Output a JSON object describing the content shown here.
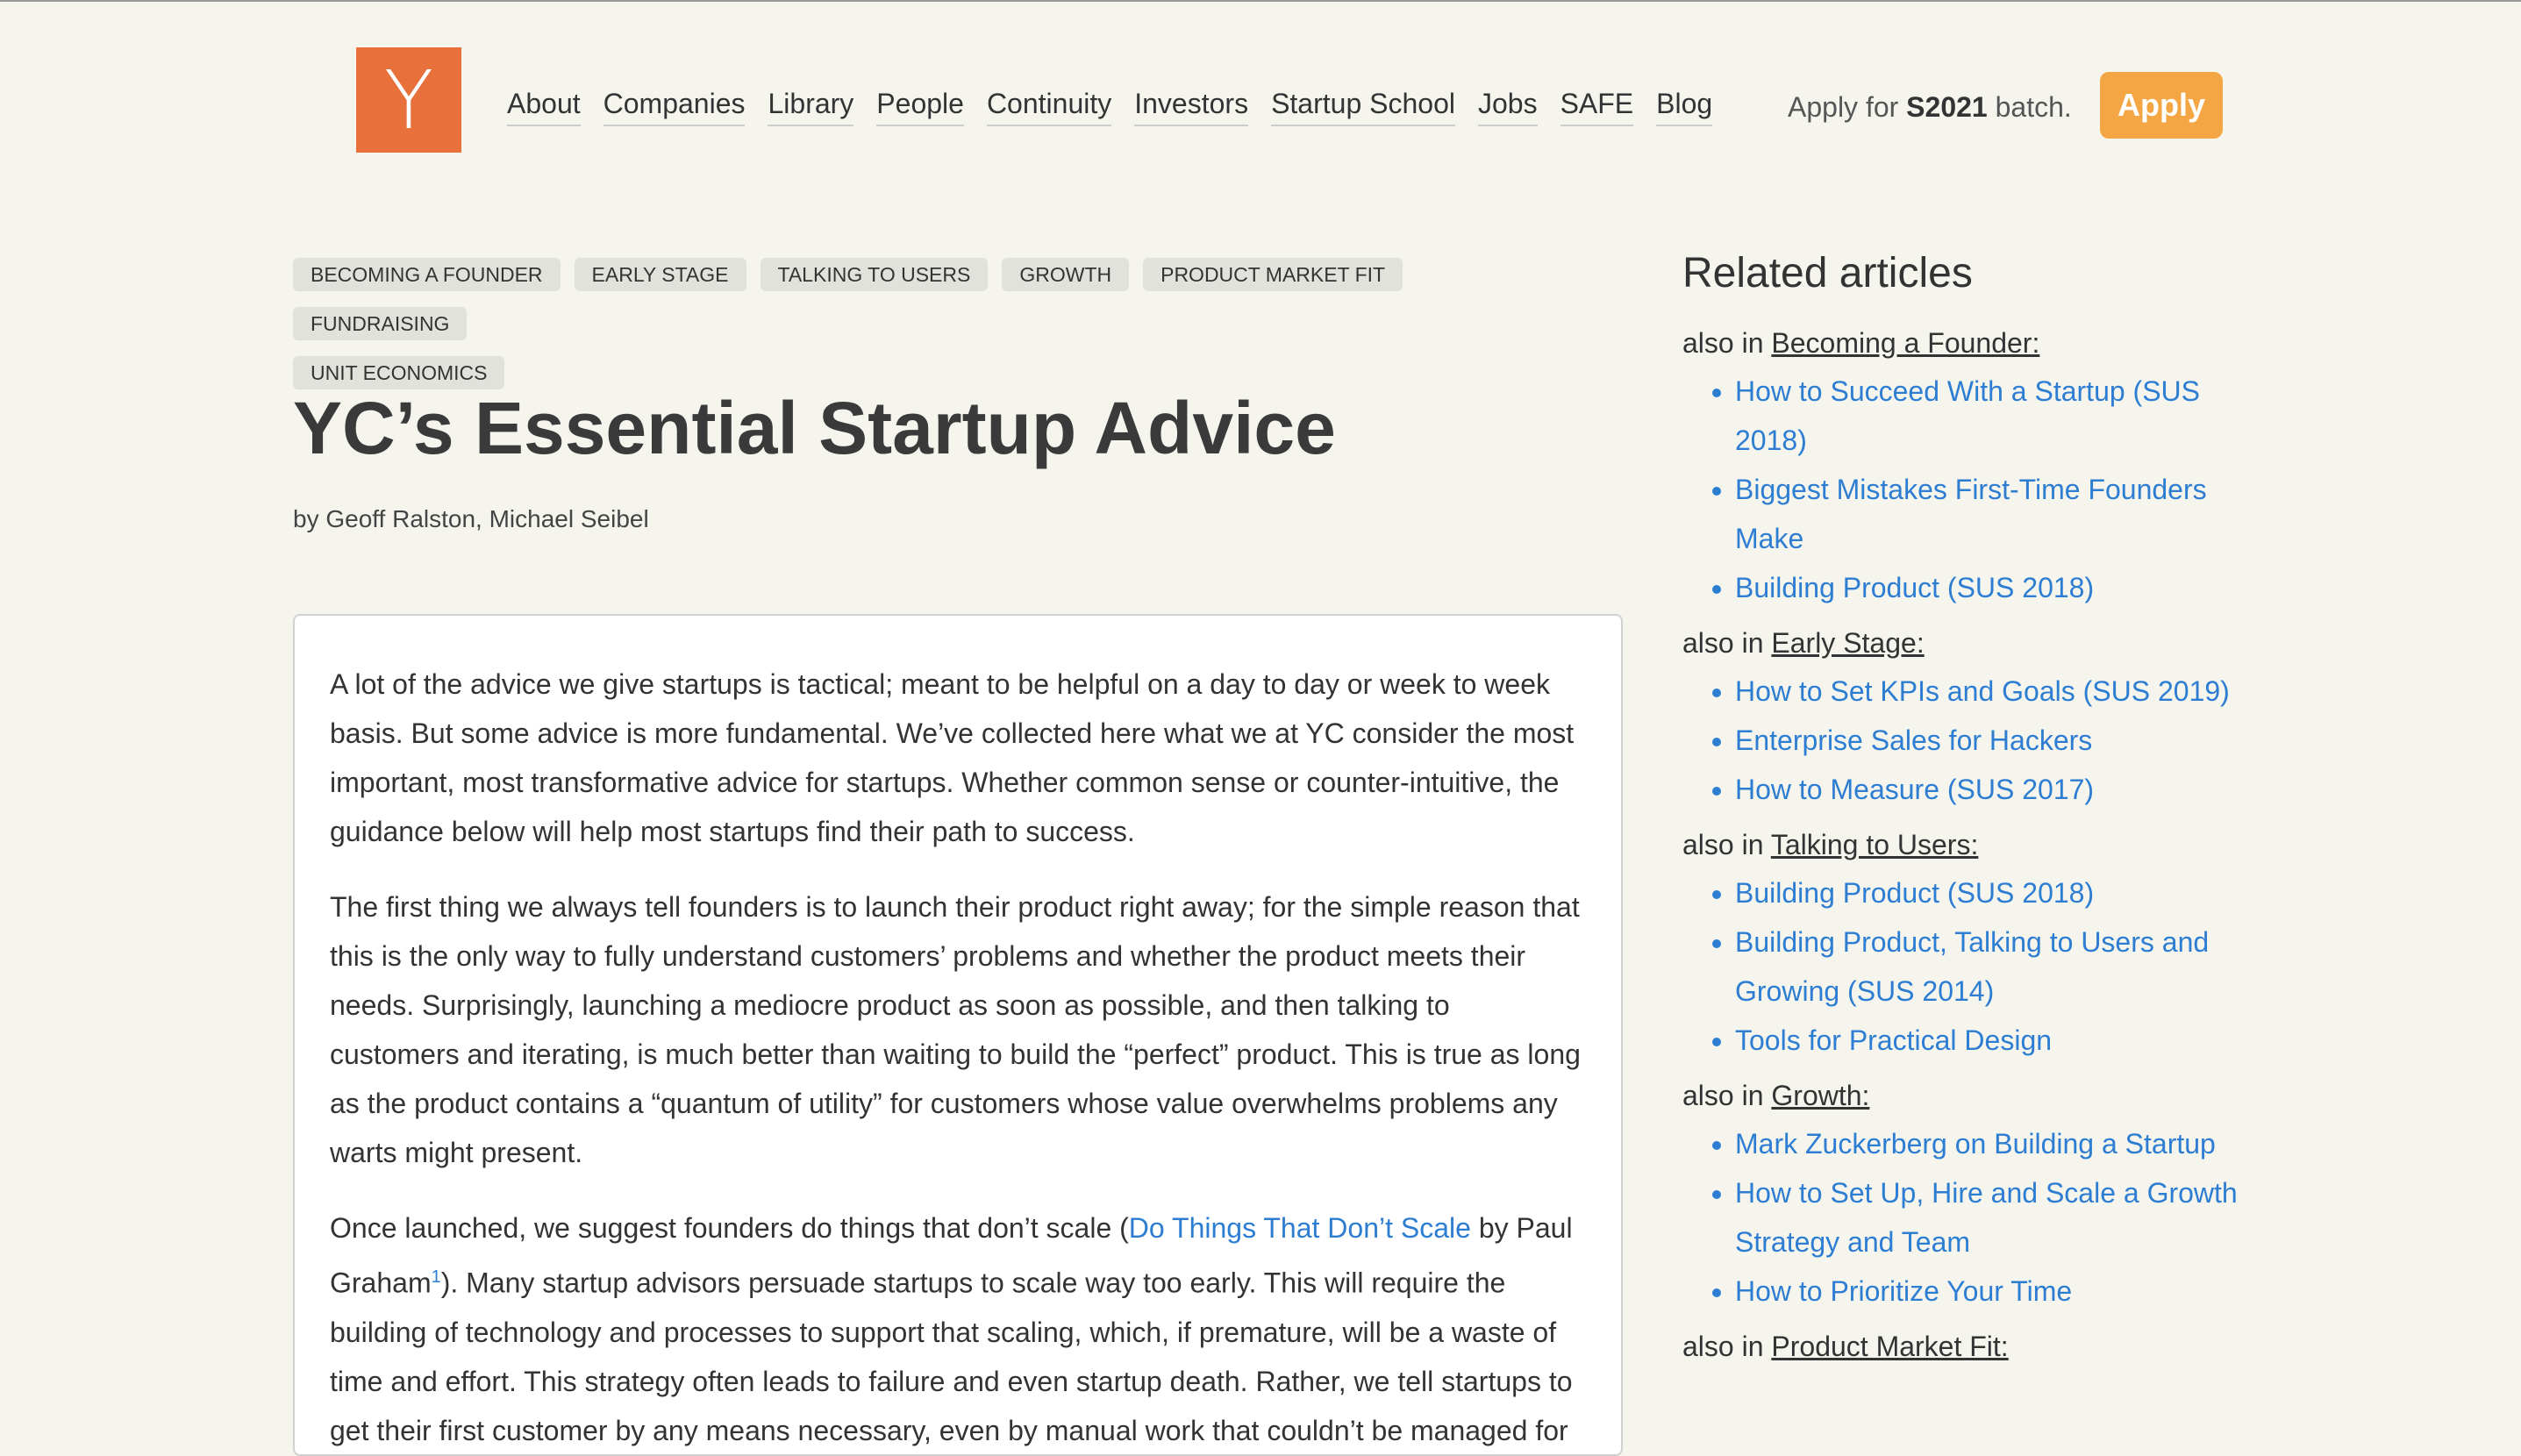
{
  "header": {
    "logo": "Y",
    "nav": [
      "About",
      "Companies",
      "Library",
      "People",
      "Continuity",
      "Investors",
      "Startup School",
      "Jobs",
      "SAFE",
      "Blog"
    ],
    "apply_prefix": "Apply for ",
    "apply_batch": "S2021",
    "apply_suffix": " batch.",
    "apply_button": "Apply"
  },
  "article": {
    "tags": [
      "BECOMING A FOUNDER",
      "EARLY STAGE",
      "TALKING TO USERS",
      "GROWTH",
      "PRODUCT MARKET FIT",
      "FUNDRAISING",
      "UNIT ECONOMICS"
    ],
    "title": "YC’s Essential Startup Advice",
    "byline": "by Geoff Ralston, Michael Seibel",
    "p1": "A lot of the advice we give startups is tactical; meant to be helpful on a day to day or week to week basis. But some advice is more fundamental. We’ve collected here what we at YC consider the most important, most transformative advice for startups. Whether common sense or counter-intuitive, the guidance below will help most startups find their path to success.",
    "p2": "The first thing we always tell founders is to launch their product right away; for the simple reason that this is the only way to fully understand customers’ problems and whether the product meets their needs. Surprisingly, launching a mediocre product as soon as possible, and then talking to customers and iterating, is much better than waiting to build the “perfect” product. This is true as long as the product contains a “quantum of utility” for customers whose value overwhelms problems any warts might present.",
    "p3_a": "Once launched, we suggest founders do things that don’t scale (",
    "p3_link": "Do Things That Don’t Scale",
    "p3_b": " by Paul Graham",
    "p3_sup": "1",
    "p3_c": "). Many startup advisors persuade startups to scale way too early. This will require the building of technology and processes to support that scaling, which, if premature, will be a waste of time and effort. This strategy often leads to failure and even startup death. Rather, we tell startups to get their first customer by any means necessary, even by manual work that couldn’t be managed for"
  },
  "sidebar": {
    "title": "Related articles",
    "also_in": "also in ",
    "groups": [
      {
        "name": "Becoming a Founder:",
        "items": [
          "How to Succeed With a Startup (SUS 2018)",
          "Biggest Mistakes First-Time Founders Make",
          "Building Product (SUS 2018)"
        ]
      },
      {
        "name": "Early Stage:",
        "items": [
          "How to Set KPIs and Goals (SUS 2019)",
          "Enterprise Sales for Hackers",
          "How to Measure (SUS 2017)"
        ]
      },
      {
        "name": "Talking to Users:",
        "items": [
          "Building Product (SUS 2018)",
          "Building Product, Talking to Users and Growing (SUS 2014)",
          "Tools for Practical Design"
        ]
      },
      {
        "name": "Growth:",
        "items": [
          "Mark Zuckerberg on Building a Startup",
          "How to Set Up, Hire and Scale a Growth Strategy and Team",
          "How to Prioritize Your Time"
        ]
      },
      {
        "name": "Product Market Fit:",
        "items": []
      }
    ]
  }
}
